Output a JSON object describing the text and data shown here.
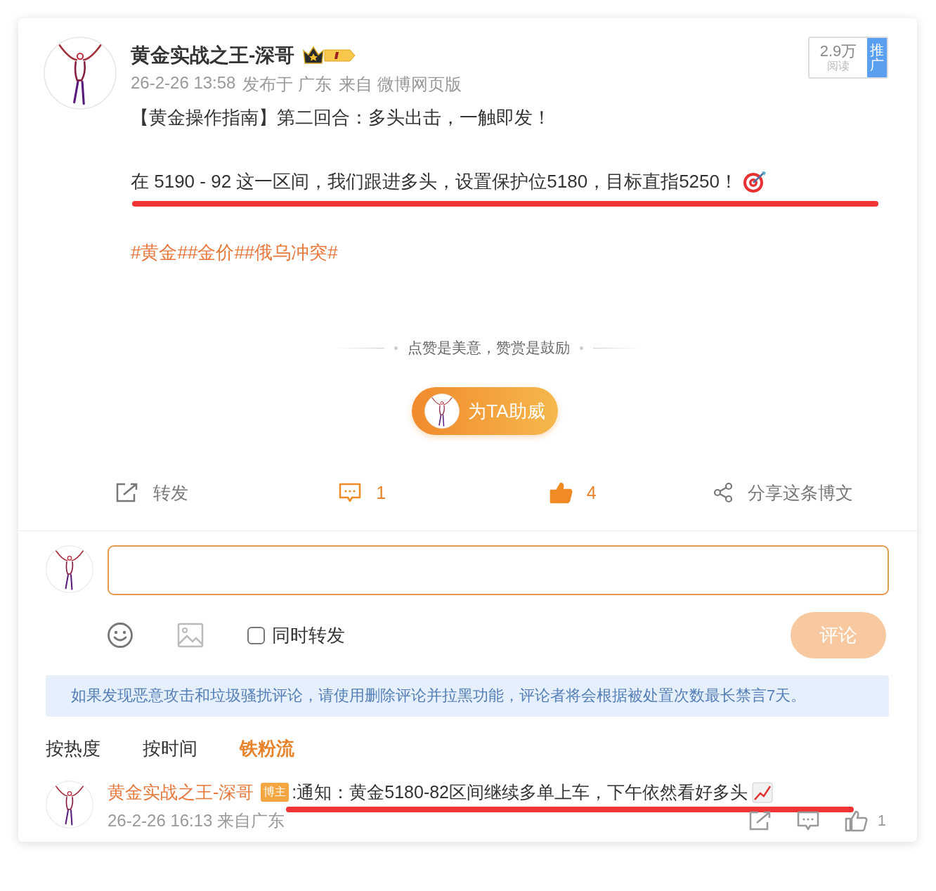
{
  "author": {
    "name": "黄金实战之王-深哥",
    "time": "26-2-26 13:58",
    "location": "发布于 广东",
    "source": "来自 微博网页版"
  },
  "read_stat": {
    "count": "2.9万",
    "label": "阅读",
    "promote": "推广"
  },
  "post": {
    "title": "【黄金操作指南】第二回合：多头出击，一触即发！",
    "body": "在 5190 - 92 这一区间，我们跟进多头，设置保护位5180，目标直指5250！",
    "tags": [
      "#黄金#",
      "#金价#",
      "#俄乌冲突#"
    ]
  },
  "reward": {
    "slogan": "点赞是美意，赞赏是鼓励",
    "button": "为TA助威"
  },
  "actions": [
    {
      "kind": "repost",
      "label": "转发",
      "active": false
    },
    {
      "kind": "comment",
      "label": "1",
      "active": true
    },
    {
      "kind": "like",
      "label": "4",
      "active": true
    },
    {
      "kind": "share",
      "label": "分享这条博文",
      "active": false
    }
  ],
  "composer": {
    "repost_too": {
      "label": "同时转发",
      "checked": false
    },
    "submit": "评论",
    "disabled": true
  },
  "notice": "如果发现恶意攻击和垃圾骚扰评论，请使用删除评论并拉黑功能，评论者将会根据被处置次数最长禁言7天。",
  "sort_tabs": [
    {
      "label": "按热度",
      "selected": false
    },
    {
      "label": "按时间",
      "selected": false
    },
    {
      "label": "铁粉流",
      "selected": true
    }
  ],
  "comments": [
    {
      "author": "黄金实战之王-深哥",
      "badge": "博主",
      "text": ":通知：黄金5180-82区间继续多单上车，下午依然看好多头",
      "time": "26-2-26 16:13 来自广东",
      "likes": "1"
    }
  ]
}
